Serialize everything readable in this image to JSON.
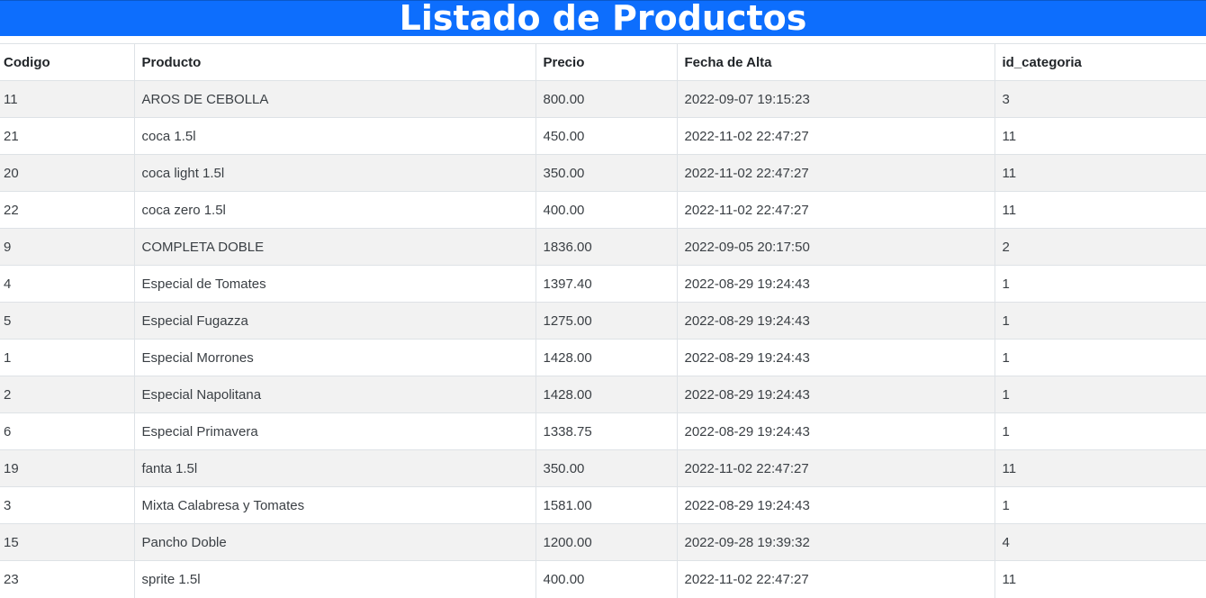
{
  "page": {
    "title": "Listado de Productos"
  },
  "table": {
    "headers": [
      "Codigo",
      "Producto",
      "Precio",
      "Fecha de Alta",
      "id_categoria"
    ],
    "rows": [
      [
        "11",
        "AROS DE CEBOLLA",
        "800.00",
        "2022-09-07 19:15:23",
        "3"
      ],
      [
        "21",
        "coca 1.5l",
        "450.00",
        "2022-11-02 22:47:27",
        "11"
      ],
      [
        "20",
        "coca light 1.5l",
        "350.00",
        "2022-11-02 22:47:27",
        "11"
      ],
      [
        "22",
        "coca zero 1.5l",
        "400.00",
        "2022-11-02 22:47:27",
        "11"
      ],
      [
        "9",
        "COMPLETA DOBLE",
        "1836.00",
        "2022-09-05 20:17:50",
        "2"
      ],
      [
        "4",
        "Especial de Tomates",
        "1397.40",
        "2022-08-29 19:24:43",
        "1"
      ],
      [
        "5",
        "Especial Fugazza",
        "1275.00",
        "2022-08-29 19:24:43",
        "1"
      ],
      [
        "1",
        "Especial Morrones",
        "1428.00",
        "2022-08-29 19:24:43",
        "1"
      ],
      [
        "2",
        "Especial Napolitana",
        "1428.00",
        "2022-08-29 19:24:43",
        "1"
      ],
      [
        "6",
        "Especial Primavera",
        "1338.75",
        "2022-08-29 19:24:43",
        "1"
      ],
      [
        "19",
        "fanta 1.5l",
        "350.00",
        "2022-11-02 22:47:27",
        "11"
      ],
      [
        "3",
        "Mixta Calabresa y Tomates",
        "1581.00",
        "2022-08-29 19:24:43",
        "1"
      ],
      [
        "15",
        "Pancho Doble",
        "1200.00",
        "2022-09-28 19:39:32",
        "4"
      ],
      [
        "23",
        "sprite 1.5l",
        "400.00",
        "2022-11-02 22:47:27",
        "11"
      ]
    ]
  },
  "colors": {
    "header_bg": "#0d6efd",
    "header_text": "#ffffff",
    "stripe": "#f2f2f2",
    "border": "#dee2e6"
  }
}
